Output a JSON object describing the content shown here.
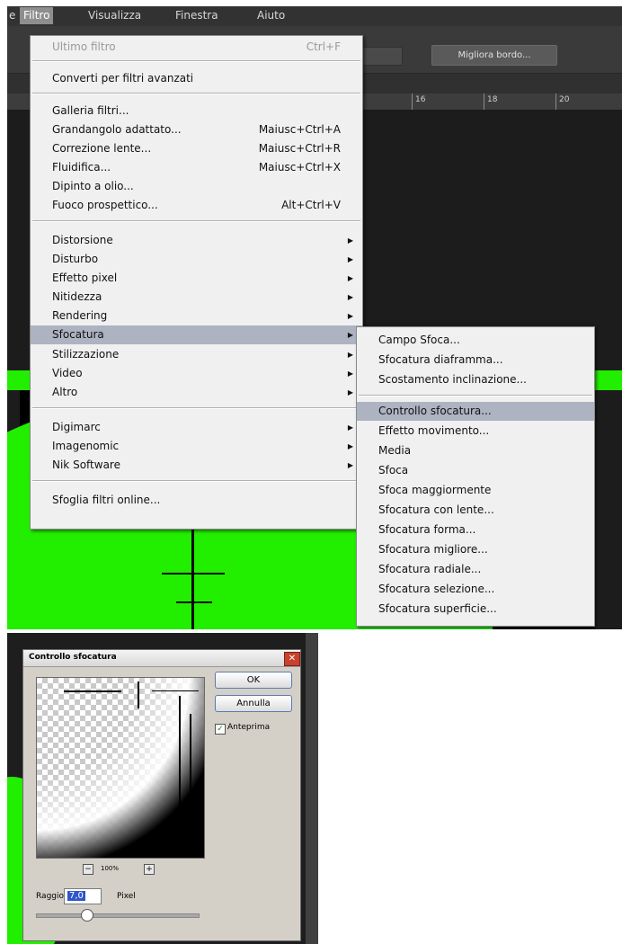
{
  "menubar": {
    "items": [
      {
        "label": "e"
      },
      {
        "label": "Filtro"
      },
      {
        "label": "Visualizza"
      },
      {
        "label": "Finestra"
      },
      {
        "label": "Aiuto"
      }
    ]
  },
  "options_bar": {
    "refine_edge_button": "Migliora bordo..."
  },
  "ruler": {
    "labels": [
      "16",
      "18",
      "20"
    ]
  },
  "filtro_menu": {
    "items": [
      {
        "label": "Ultimo filtro",
        "shortcut": "Ctrl+F"
      },
      {
        "label": "Converti per filtri avanzati"
      },
      {
        "label": "Galleria filtri..."
      },
      {
        "label": "Grandangolo adattato...",
        "shortcut": "Maiusc+Ctrl+A"
      },
      {
        "label": "Correzione lente...",
        "shortcut": "Maiusc+Ctrl+R"
      },
      {
        "label": "Fluidifica...",
        "shortcut": "Maiusc+Ctrl+X"
      },
      {
        "label": "Dipinto a olio..."
      },
      {
        "label": "Fuoco prospettico...",
        "shortcut": "Alt+Ctrl+V"
      },
      {
        "label": "Distorsione"
      },
      {
        "label": "Disturbo"
      },
      {
        "label": "Effetto pixel"
      },
      {
        "label": "Nitidezza"
      },
      {
        "label": "Rendering"
      },
      {
        "label": "Sfocatura"
      },
      {
        "label": "Stilizzazione"
      },
      {
        "label": "Video"
      },
      {
        "label": "Altro"
      },
      {
        "label": "Digimarc"
      },
      {
        "label": "Imagenomic"
      },
      {
        "label": "Nik Software"
      },
      {
        "label": "Sfoglia filtri online..."
      }
    ]
  },
  "sfocatura_submenu": {
    "items": [
      {
        "label": "Campo Sfoca..."
      },
      {
        "label": "Sfocatura diaframma..."
      },
      {
        "label": "Scostamento inclinazione..."
      },
      {
        "label": "Controllo sfocatura..."
      },
      {
        "label": "Effetto movimento..."
      },
      {
        "label": "Media"
      },
      {
        "label": "Sfoca"
      },
      {
        "label": "Sfoca maggiormente"
      },
      {
        "label": "Sfocatura con lente..."
      },
      {
        "label": "Sfocatura forma..."
      },
      {
        "label": "Sfocatura migliore..."
      },
      {
        "label": "Sfocatura radiale..."
      },
      {
        "label": "Sfocatura selezione..."
      },
      {
        "label": "Sfocatura superficie..."
      }
    ]
  },
  "dialog": {
    "title": "Controllo sfocatura",
    "close_glyph": "✕",
    "ok_label": "OK",
    "cancel_label": "Annulla",
    "preview_label": "Anteprima",
    "preview_checked": true,
    "zoom_out_glyph": "−",
    "zoom_in_glyph": "+",
    "zoom_value": "100%",
    "radius_label": "Raggio:",
    "radius_value": "7,0",
    "radius_unit": "Pixel"
  }
}
